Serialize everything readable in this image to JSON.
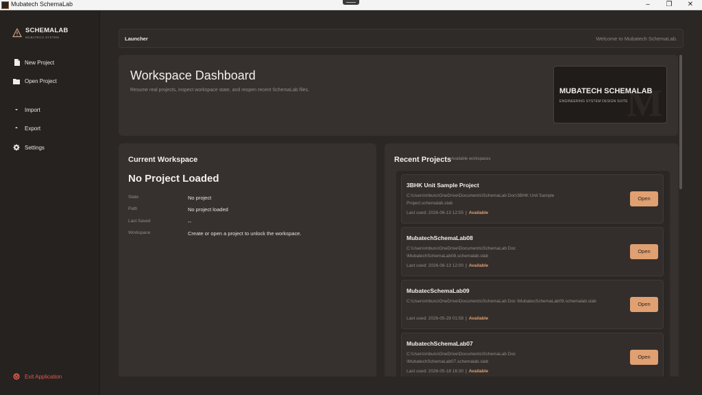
{
  "window": {
    "title": "Mubatech SchemaLab",
    "min": "–",
    "max": "❐",
    "close": "✕"
  },
  "brand": {
    "name": "SCHEMALAB",
    "sub": "MUBATECH SYSTEM"
  },
  "sidebar": {
    "items": [
      {
        "label": "New Project",
        "icon": "file-icon"
      },
      {
        "label": "Open Project",
        "icon": "folder-icon"
      },
      {
        "label": "Import",
        "icon": "import-icon"
      },
      {
        "label": "Export",
        "icon": "export-icon"
      },
      {
        "label": "Settings",
        "icon": "gear-icon"
      }
    ],
    "exit": {
      "label": "Exit Application",
      "icon": "power-icon"
    }
  },
  "launcher": {
    "label": "Launcher",
    "welcome": "Welcome to Mubatech SchemaLab."
  },
  "dashboard": {
    "title": "Workspace Dashboard",
    "description": "Resume real projects, inspect workspace state, and reopen recent SchemaLab files.",
    "banner": {
      "title": "MUBATECH SCHEMALAB",
      "subtitle": "ENGINEERING SYSTEM DESIGN SUITE",
      "watermark": "M"
    }
  },
  "workspace": {
    "heading": "Current Workspace",
    "status": "No Project Loaded",
    "rows": [
      {
        "key": "State",
        "value": "No project"
      },
      {
        "key": "Path",
        "value": "No project loaded"
      },
      {
        "key": "Last Saved",
        "value": "--"
      },
      {
        "key": "Workspace",
        "value": "Create or open a project to unlock the workspace."
      }
    ]
  },
  "recent": {
    "heading": "Recent Projects",
    "tag": "Available workspaces",
    "open_label": "Open",
    "projects": [
      {
        "name": "3BHK Unit Sample Project",
        "path": "C:\\Users\\mburu\\OneDrive\\Documents\\SchemaLab Doc\\3BHK Unit Sample Project.schemalab.slab",
        "last_used": "Last used: 2026-06-13 12:55",
        "sep": "|",
        "status": "Available"
      },
      {
        "name": "MubatechSchemaLab08",
        "path": "C:\\Users\\mburu\\OneDrive\\Documents\\SchemaLab Doc \\MubatechSchemaLab08.schemalab.slab",
        "last_used": "Last used: 2026-06-13 12:00",
        "sep": "|",
        "status": "Available"
      },
      {
        "name": "MubatecSchemaLab09",
        "path": "C:\\Users\\mburu\\OneDrive\\Documents\\SchemaLab Doc \\MubatecSchemaLab09.schemalab.slab",
        "last_used": "Last used: 2026-05-29 01:58",
        "sep": "|",
        "status": "Available"
      },
      {
        "name": "MubatechSchemaLab07",
        "path": "C:\\Users\\mburu\\OneDrive\\Documents\\SchemaLab Doc \\MubatechSchemaLab07.schemalab.slab",
        "last_used": "Last used: 2026-05-18 16:30",
        "sep": "|",
        "status": "Available"
      }
    ]
  },
  "colors": {
    "accent": "#e0a072",
    "exit": "#e25a4a",
    "background": "#2b2725",
    "panel": "#36312e"
  }
}
